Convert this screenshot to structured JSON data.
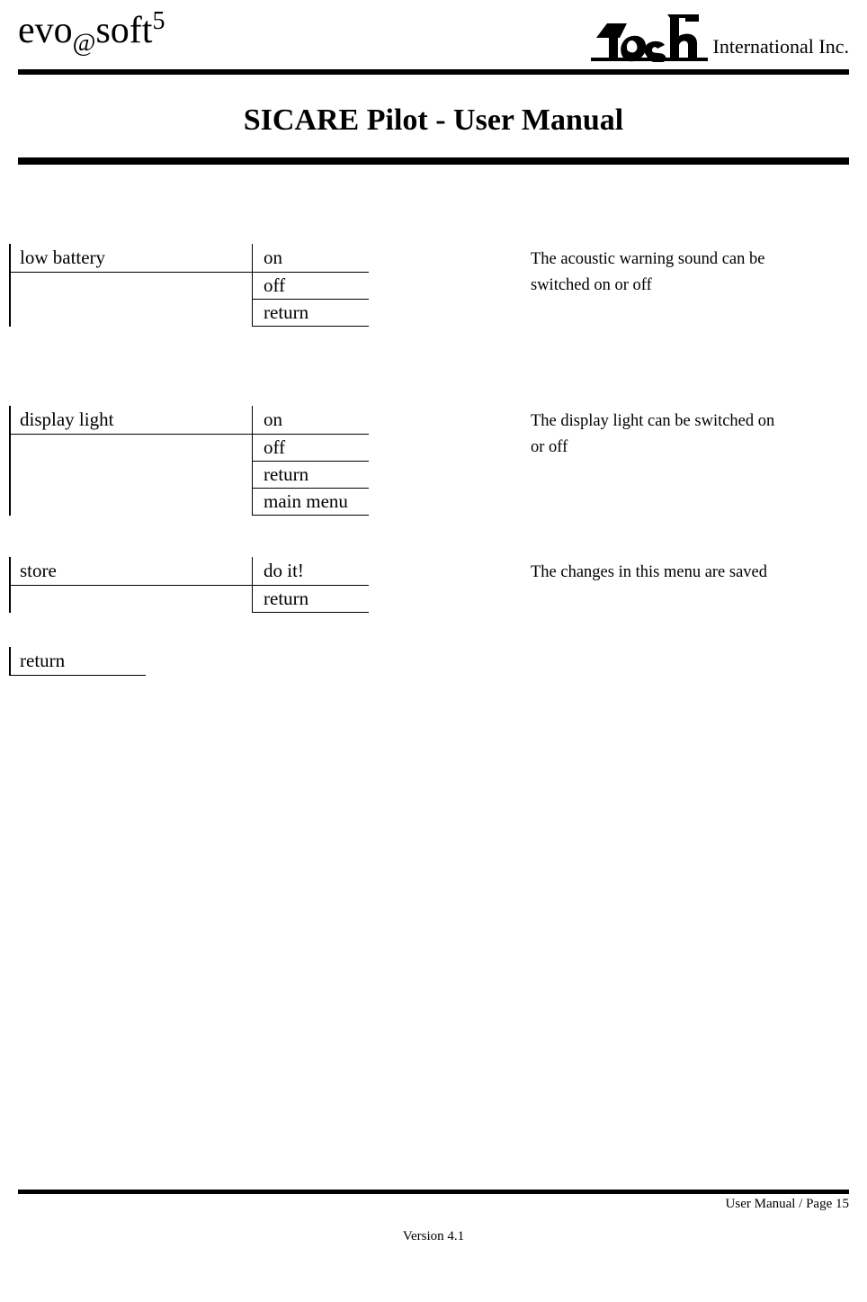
{
  "header": {
    "brand_prefix": "evo",
    "brand_at": "@",
    "brand_suffix": "soft",
    "brand_sup": "5",
    "company_suffix": "International Inc."
  },
  "title": "SICARE Pilot - User Manual",
  "sections": [
    {
      "label": "low battery",
      "options": [
        "on",
        "off",
        "return"
      ],
      "desc_lines": [
        "The acoustic warning sound can be",
        "switched on or off"
      ]
    },
    {
      "label": "display light",
      "options": [
        "on",
        "off",
        "return",
        "main menu"
      ],
      "desc_lines": [
        "The display light can be switched on",
        "or off"
      ]
    },
    {
      "label": "store",
      "options": [
        "do it!",
        "return"
      ],
      "desc_lines": [
        "The changes in this menu are saved",
        ""
      ]
    }
  ],
  "final_return": "return",
  "footer": {
    "version": "Version 4.1",
    "page_label": "User Manual / Page 15"
  }
}
